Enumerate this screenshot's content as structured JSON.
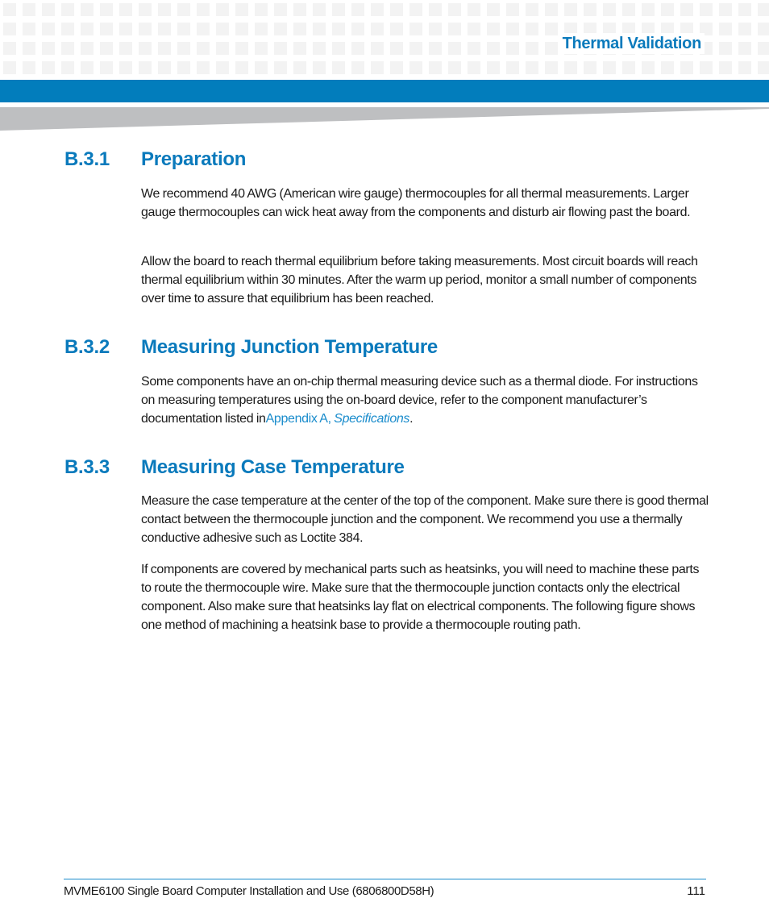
{
  "header": {
    "title": "Thermal Validation"
  },
  "sections": [
    {
      "number": "B.3.1",
      "title": "Preparation",
      "paragraphs": [
        "We recommend 40 AWG (American wire gauge) thermocouples for all thermal measurements. Larger gauge thermocouples can wick heat away from the components and disturb air flowing past the board.",
        "Allow the board to reach thermal equilibrium before taking measurements. Most circuit boards will reach thermal equilibrium within 30 minutes. After the warm up period, monitor a small number of components over time to assure that equilibrium has been reached."
      ]
    },
    {
      "number": "B.3.2",
      "title": "Measuring Junction Temperature",
      "paragraphs": [
        {
          "text_before": "Some components have an on-chip thermal measuring device such as a thermal diode. For instructions on measuring temperatures using the on-board device, refer to the component manufacturer’s documentation listed in",
          "link_text": "Appendix A, ",
          "link_italic": "Specifications",
          "text_after": "."
        }
      ]
    },
    {
      "number": "B.3.3",
      "title": "Measuring Case Temperature",
      "paragraphs": [
        "Measure the case temperature at the center of the top of the component. Make sure there is good thermal contact between the thermocouple junction and the component. We recommend you use a thermally conductive adhesive such as Loctite 384.",
        "If components are covered by mechanical parts such as heatsinks, you will need to machine these parts to route the thermocouple wire. Make sure that the thermocouple junction contacts only the electrical component. Also make sure that heatsinks lay flat on electrical components. The following figure shows one method of machining a heatsink base to provide a thermocouple routing path."
      ]
    }
  ],
  "footer": {
    "document_title": "MVME6100 Single Board Computer Installation and Use (6806800D58H)",
    "page_number": "111"
  },
  "colors": {
    "accent_blue": "#027dbc",
    "heading_blue": "#0a7abc",
    "link_blue": "#1a8ccc",
    "wedge_gray": "#bebfc1",
    "pattern_gray": "#f3f3f3"
  }
}
